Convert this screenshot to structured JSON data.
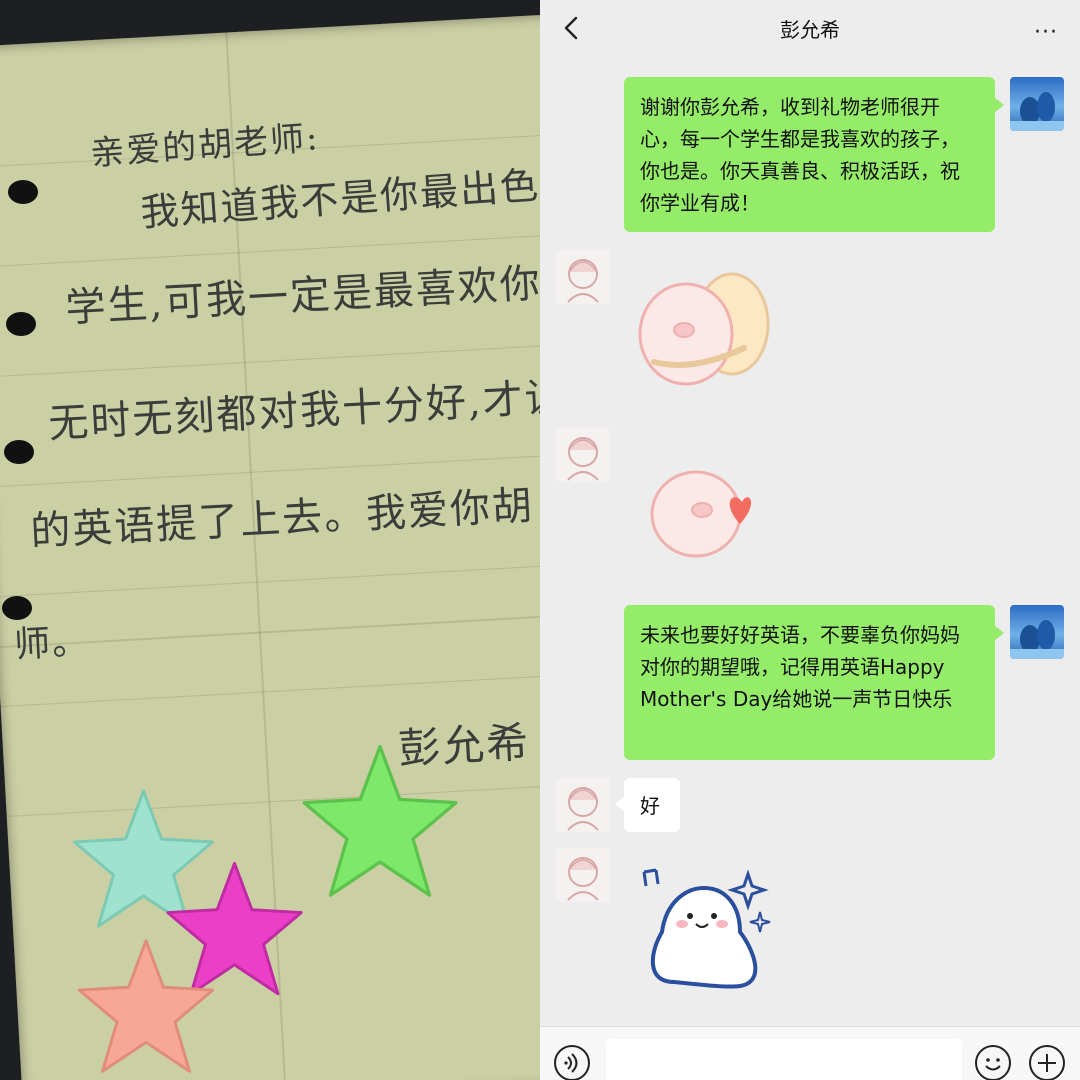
{
  "photo": {
    "handwriting": [
      "亲爱的胡老师:",
      "我知道我不是你最出色",
      "学生,可我一定是最喜欢你的",
      "无时无刻都对我十分好,才让",
      "的英语提了上去。我爱你胡",
      "师。",
      "彭允希"
    ]
  },
  "header": {
    "title": "彭允希",
    "back_icon": "chevron-left-icon",
    "more_label": "···"
  },
  "messages": [
    {
      "from": "me",
      "type": "text",
      "text": "谢谢你彭允希，收到礼物老师很开心，每一个学生都是我喜欢的孩子，你也是。你天真善良、积极活跃，祝你学业有成！"
    },
    {
      "from": "her",
      "type": "sticker",
      "sticker": "hugging-pigs-sticker"
    },
    {
      "from": "her",
      "type": "sticker",
      "sticker": "pig-with-heart-sticker"
    },
    {
      "from": "me",
      "type": "text",
      "text": "未来也要好好英语，不要辜负你妈妈对你的期望哦，记得用英语Happy Mother's Day给她说一声节日快乐"
    },
    {
      "from": "her",
      "type": "text",
      "text": "好"
    },
    {
      "from": "her",
      "type": "sticker",
      "sticker": "happy-ghost-sticker"
    }
  ],
  "input_bar": {
    "voice_icon": "voice-icon",
    "emoji_icon": "emoji-icon",
    "plus_icon": "plus-icon",
    "text_value": ""
  },
  "colors": {
    "my_bubble": "#95ec69",
    "her_bubble": "#ffffff",
    "chat_background": "#ededed"
  }
}
